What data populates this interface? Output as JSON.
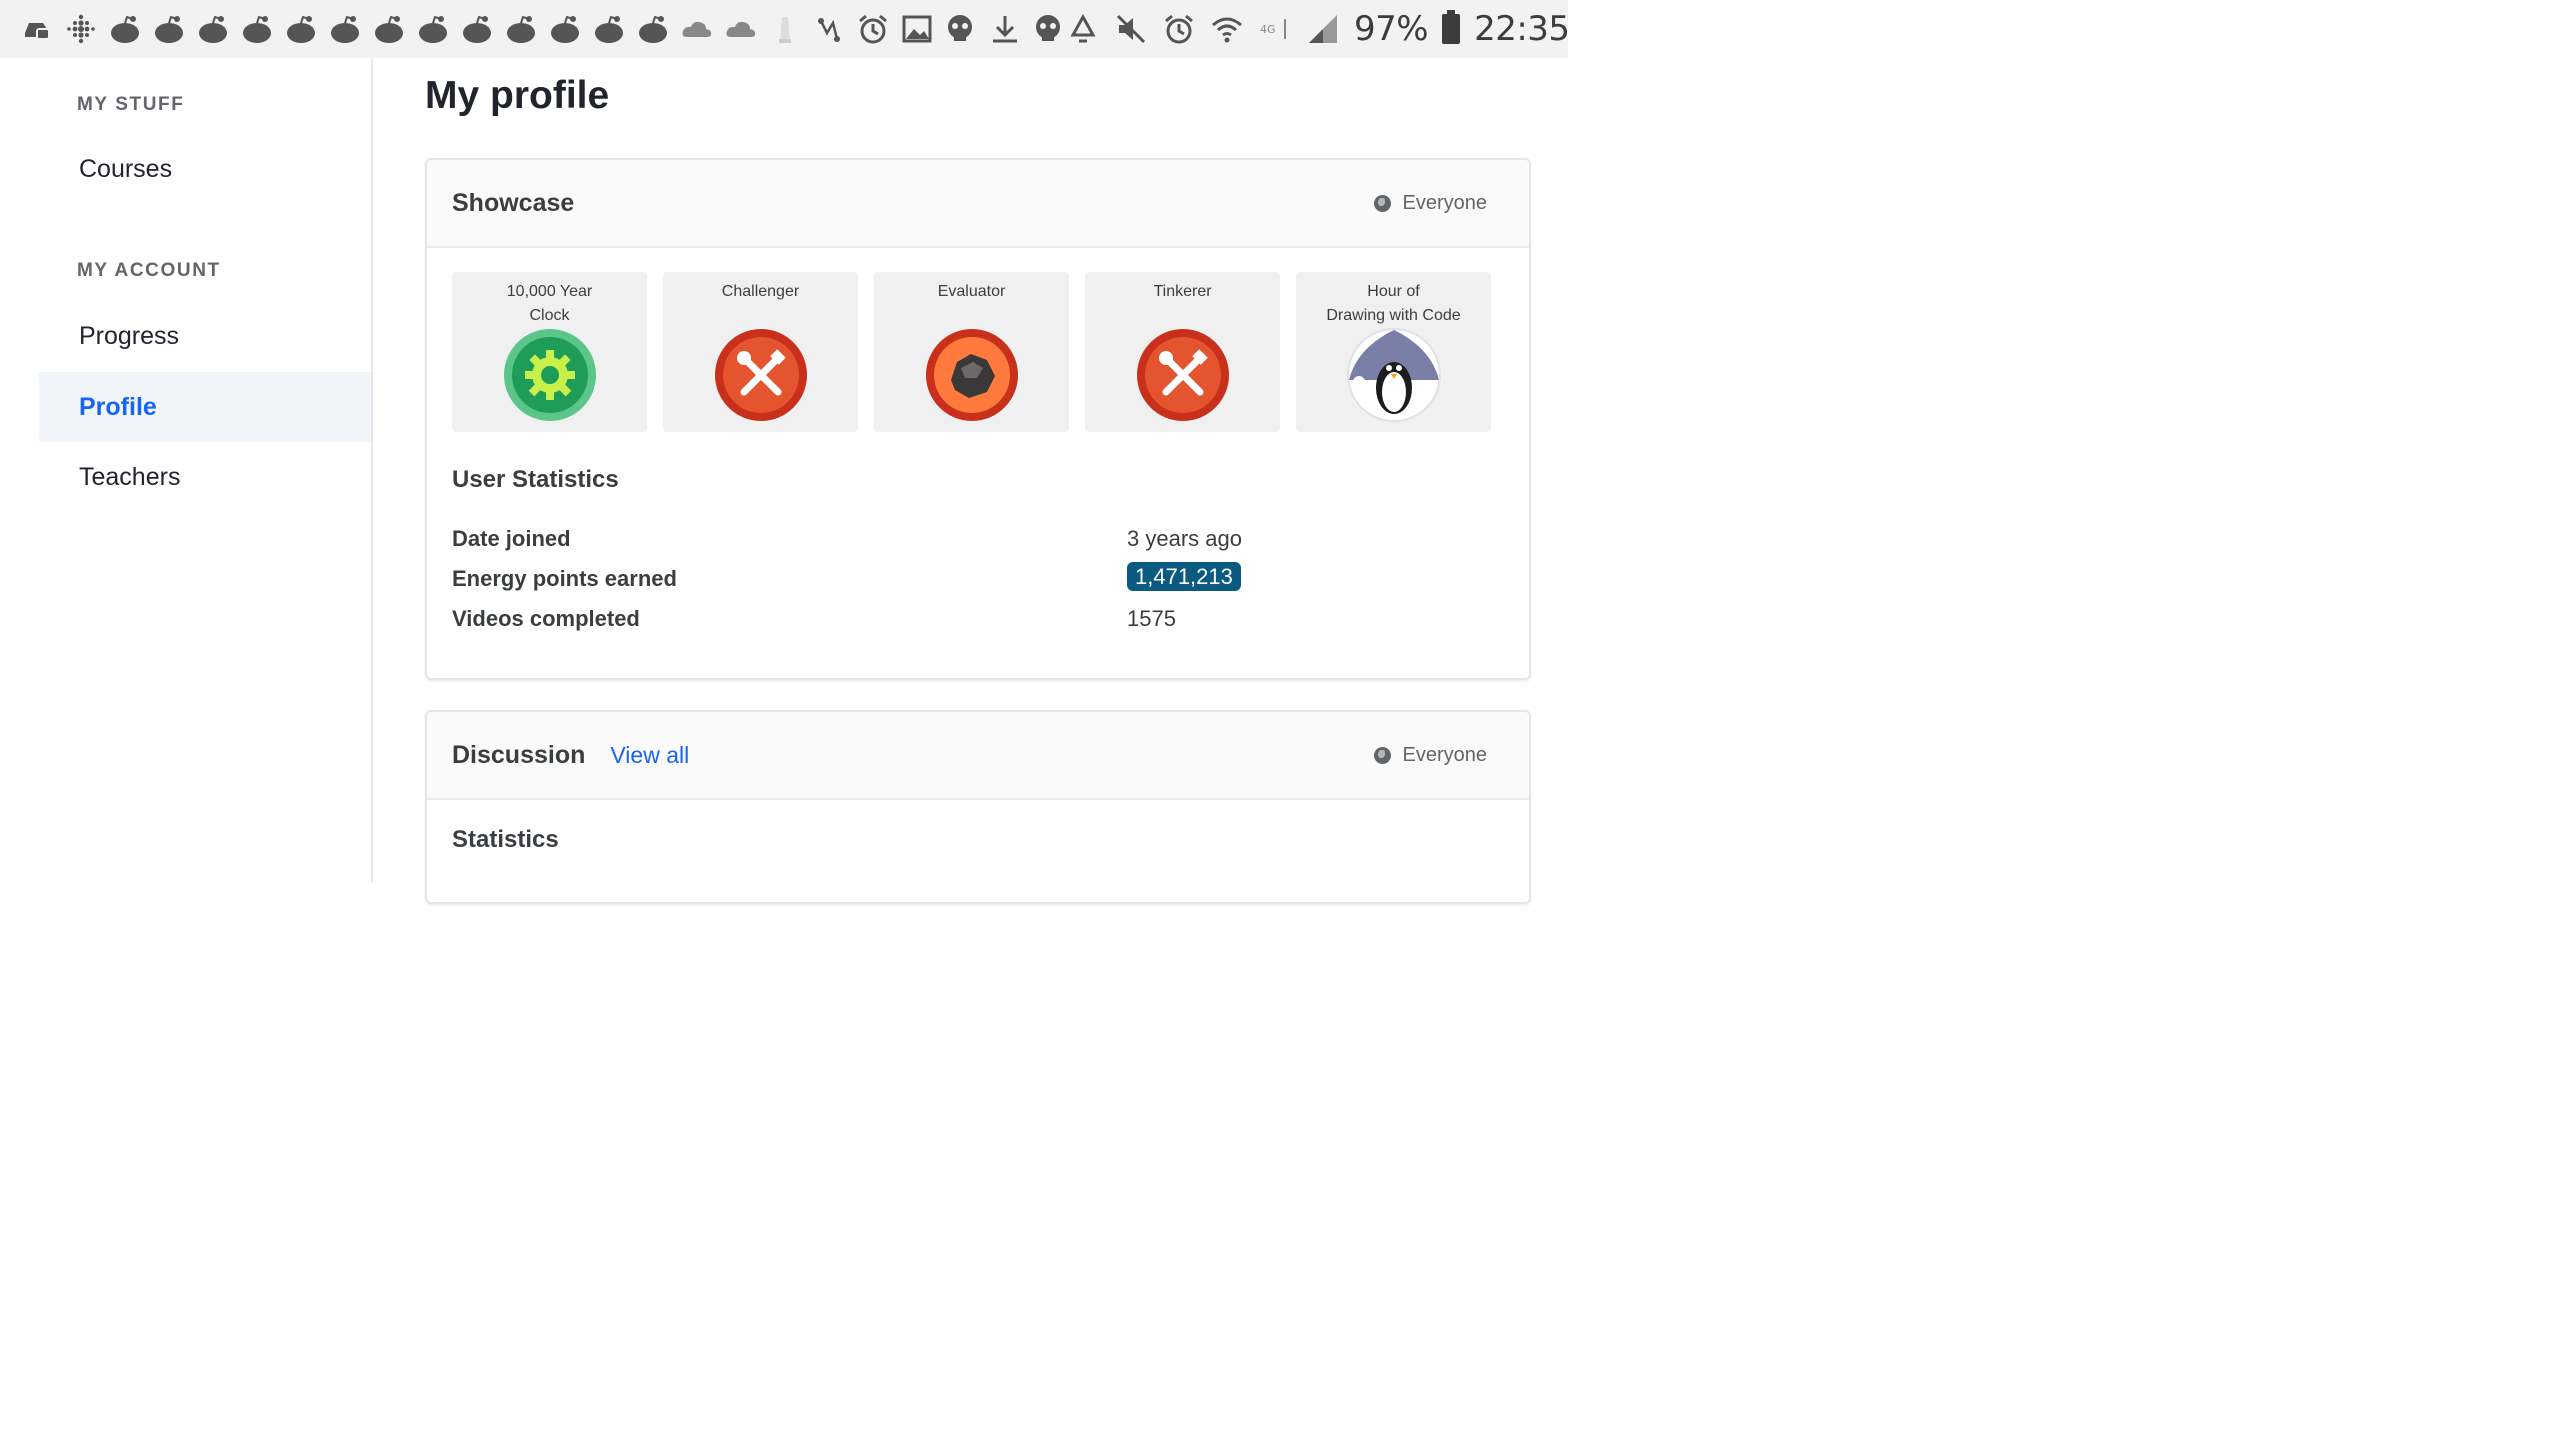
{
  "statusbar": {
    "left_icons": [
      "car-notification-icon",
      "fitbit-icon",
      "reddit-icon",
      "reddit-icon",
      "reddit-icon",
      "reddit-icon",
      "reddit-icon",
      "reddit-icon",
      "reddit-icon",
      "reddit-icon",
      "reddit-icon",
      "reddit-icon",
      "reddit-icon",
      "reddit-icon",
      "cloud-icon",
      "cloud-icon",
      "lighthouse-icon",
      "route-icon",
      "alarm-icon",
      "image-icon",
      "skull-icon",
      "download-icon",
      "skull-icon"
    ],
    "right_icons": [
      "recycle-icon",
      "mute-icon",
      "alarm-icon",
      "wifi-icon",
      "lte-icon",
      "signal-icon"
    ],
    "battery": "97%",
    "time": "22:35"
  },
  "sidebar": {
    "my_stuff_heading": "MY STUFF",
    "courses": "Courses",
    "my_account_heading": "MY ACCOUNT",
    "progress": "Progress",
    "profile": "Profile",
    "teachers": "Teachers"
  },
  "page_title": "My profile",
  "showcase": {
    "title": "Showcase",
    "visibility": "Everyone",
    "badges": [
      {
        "name": "10,000 Year\nClock",
        "icon": "gear-badge-icon"
      },
      {
        "name": "Challenger",
        "icon": "tools-badge-icon"
      },
      {
        "name": "Evaluator",
        "icon": "rock-badge-icon"
      },
      {
        "name": "Tinkerer",
        "icon": "tools-badge-icon"
      },
      {
        "name": "Hour of\nDrawing with Code",
        "icon": "penguin-badge-icon"
      }
    ],
    "user_statistics": {
      "title": "User Statistics",
      "date_joined_label": "Date joined",
      "date_joined_value": "3 years ago",
      "energy_label": "Energy points earned",
      "energy_value": "1,471,213",
      "videos_label": "Videos completed",
      "videos_value": "1575"
    }
  },
  "discussion": {
    "title": "Discussion",
    "view_all": "View all",
    "visibility": "Everyone",
    "statistics_title": "Statistics"
  },
  "colors": {
    "accent": "#1865f2",
    "energy_pill": "#0a5a82",
    "active_bg": "#f1f4f8"
  }
}
